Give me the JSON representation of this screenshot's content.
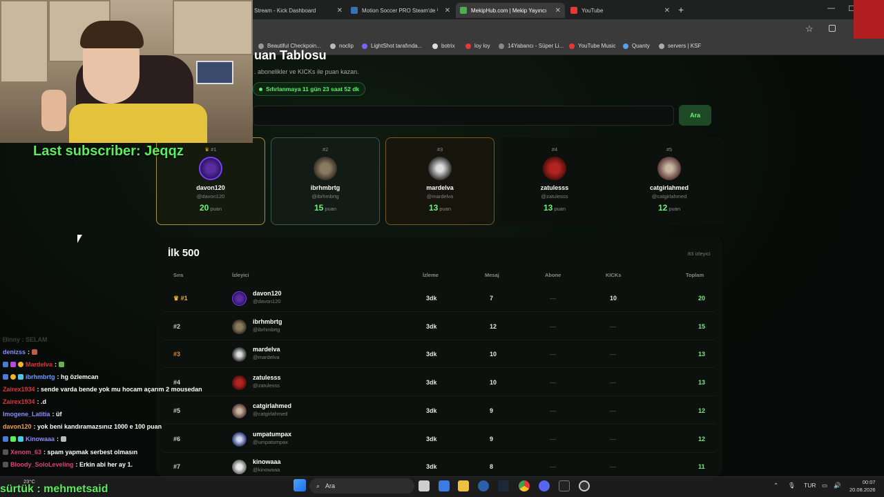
{
  "browser": {
    "tabs": [
      {
        "title": "Stream - Kick Dashboard"
      },
      {
        "title": "Motion Soccer PRO Steam'de %"
      },
      {
        "title": "MekipHub.com | Mekip Yayıncı"
      },
      {
        "title": "YouTube"
      }
    ],
    "bookmarks": [
      "Beautiful Checkpoin...",
      "noclip",
      "LightShot tarafında...",
      "botrix",
      "loy loy",
      "14Yabancı - Süper Li...",
      "YouTube Music",
      "Quanty",
      "servers | KSF"
    ]
  },
  "page": {
    "title": "uan Tablosu",
    "subtitle": ". abonelikler ve KICKs ile puan kazan.",
    "reset": "Sıfırlanmaya 11 gün 23 saat 52 dk",
    "search_button": "Ara"
  },
  "podium": [
    {
      "rank": "#1",
      "name": "davon120",
      "handle": "@davon120",
      "points": "20",
      "unit": "puan"
    },
    {
      "rank": "#2",
      "name": "ibrhmbrtg",
      "handle": "@ibrhmbrtg",
      "points": "15",
      "unit": "puan"
    },
    {
      "rank": "#3",
      "name": "mardelva",
      "handle": "@mardelva",
      "points": "13",
      "unit": "puan"
    },
    {
      "rank": "#4",
      "name": "zatulesss",
      "handle": "@zatulesss",
      "points": "13",
      "unit": "puan"
    },
    {
      "rank": "#5",
      "name": "catgirlahmed",
      "handle": "@catgirlahmed",
      "points": "12",
      "unit": "puan"
    }
  ],
  "table": {
    "title": "İlk 500",
    "count": "83 izleyici",
    "headers": {
      "rank": "Sıra",
      "viewer": "İzleyici",
      "watch": "İzleme",
      "messages": "Mesaj",
      "sub": "Abone",
      "kicks": "KICKs",
      "total": "Toplam"
    },
    "rows": [
      {
        "rank": "#1",
        "name": "davon120",
        "handle": "@davon120",
        "watch": "3dk",
        "messages": "7",
        "sub": "—",
        "kicks": "10",
        "total": "20"
      },
      {
        "rank": "#2",
        "name": "ibrhmbrtg",
        "handle": "@ibrhmbrtg",
        "watch": "3dk",
        "messages": "12",
        "sub": "—",
        "kicks": "—",
        "total": "15"
      },
      {
        "rank": "#3",
        "name": "mardelva",
        "handle": "@mardelva",
        "watch": "3dk",
        "messages": "10",
        "sub": "—",
        "kicks": "—",
        "total": "13"
      },
      {
        "rank": "#4",
        "name": "zatulesss",
        "handle": "@zatulesss",
        "watch": "3dk",
        "messages": "10",
        "sub": "—",
        "kicks": "—",
        "total": "13"
      },
      {
        "rank": "#5",
        "name": "catgirlahmed",
        "handle": "@catgirlahmed",
        "watch": "3dk",
        "messages": "9",
        "sub": "—",
        "kicks": "—",
        "total": "12"
      },
      {
        "rank": "#6",
        "name": "umpatumpax",
        "handle": "@umpatumpax",
        "watch": "3dk",
        "messages": "9",
        "sub": "—",
        "kicks": "—",
        "total": "12"
      },
      {
        "rank": "#7",
        "name": "kinowaaa",
        "handle": "@kinowaaa",
        "watch": "3dk",
        "messages": "8",
        "sub": "—",
        "kicks": "—",
        "total": "11"
      }
    ]
  },
  "overlay": {
    "last_subscriber": "Last subscriber: Jeqqz",
    "follower": "sürtük : mehmetsaid"
  },
  "chat": [
    {
      "user": "ᗷinny : SELAM",
      "text": ""
    },
    {
      "user": "denizss",
      "text": ""
    },
    {
      "user": "Mardelva",
      "text": ""
    },
    {
      "user": "ibrhmbrtg",
      "text": "hg özlemcan"
    },
    {
      "user": "Zairex1934",
      "text": "sende varda bende yok mu hocam açarım 2 mousedan"
    },
    {
      "user": "Zairex1934",
      "text": ".d"
    },
    {
      "user": "Imogene_Latitia",
      "text": "üf"
    },
    {
      "user": "davon120",
      "text": "yok beni kandıramazsınız 1000 e 100 puan"
    },
    {
      "user": "Kinowaaa",
      "text": ""
    },
    {
      "user": "Xenom_63",
      "text": "spam yapmak serbest olmasın"
    },
    {
      "user": "Bloody_SoloLeveling",
      "text": "Erkin abi her ay 1."
    }
  ],
  "taskbar": {
    "search": "Ara",
    "weather": "23°C",
    "language": "TUR",
    "time": "00:07",
    "date": "20.08.2026"
  }
}
